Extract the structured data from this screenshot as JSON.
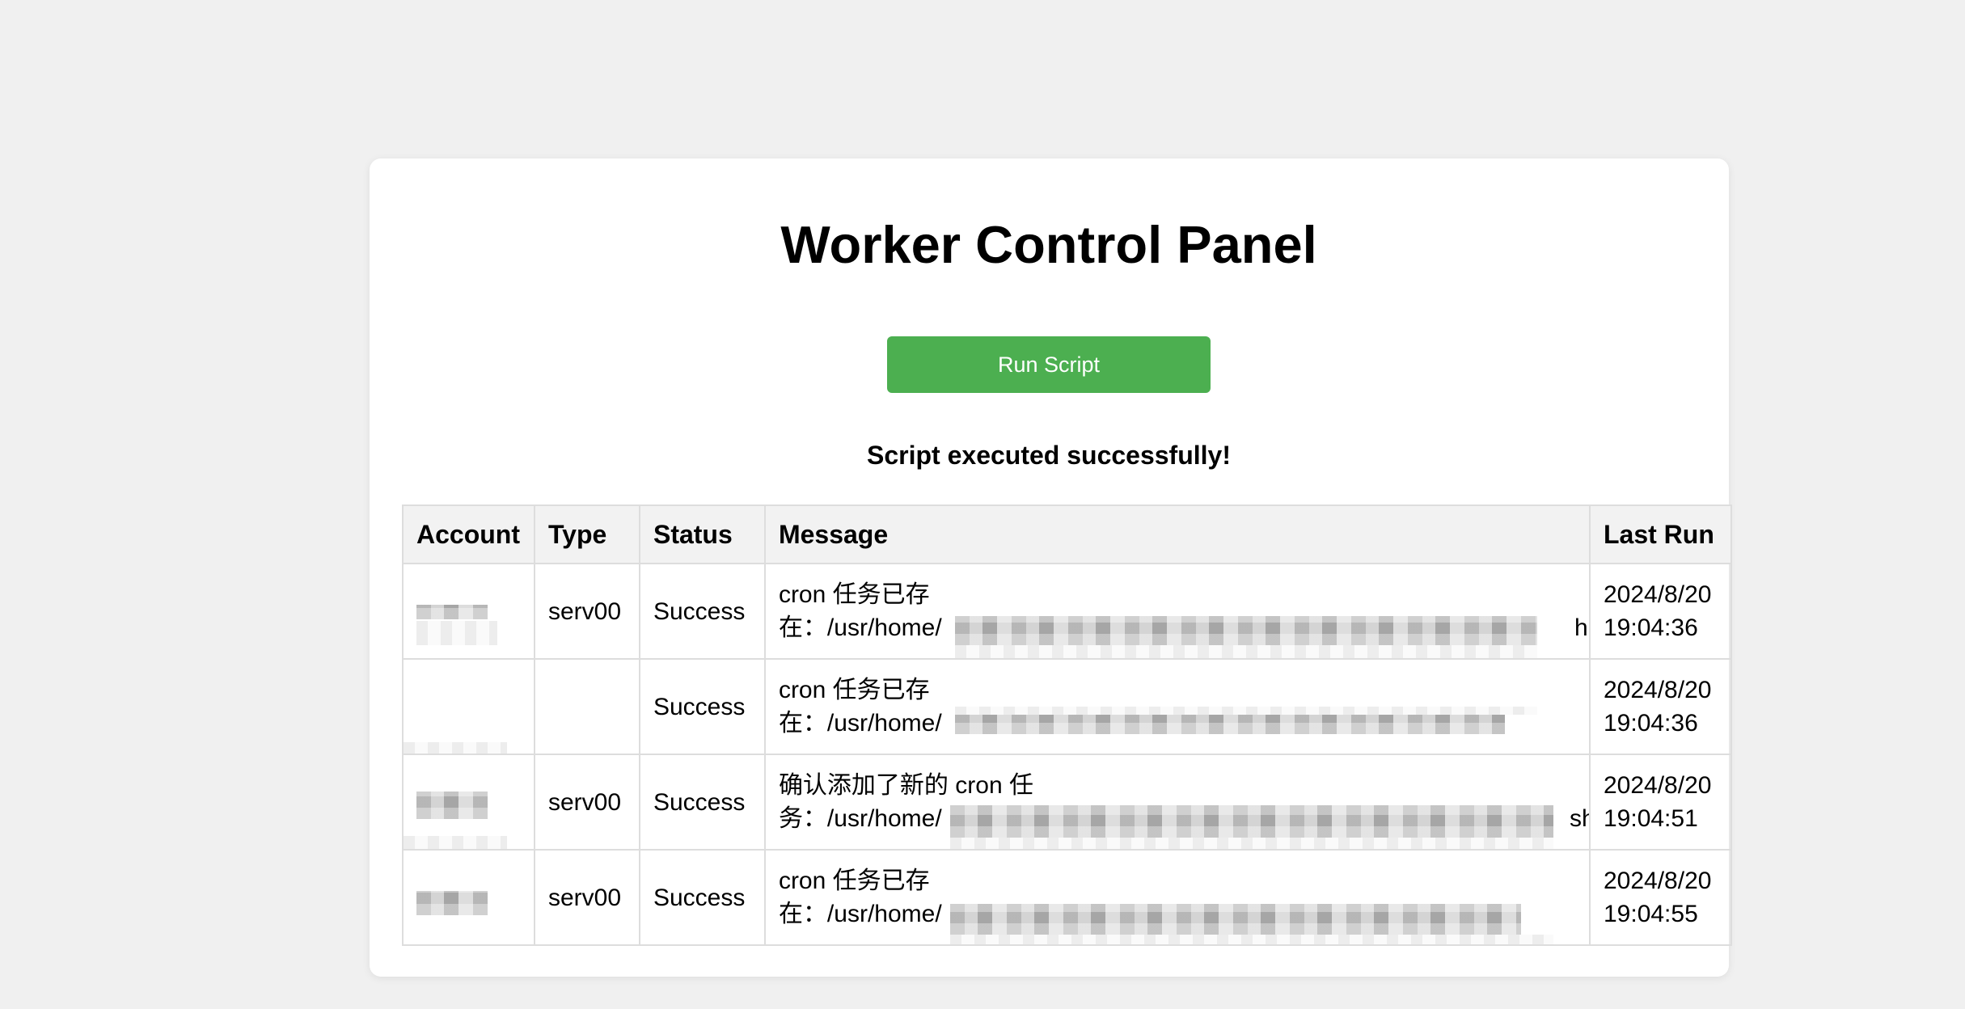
{
  "page": {
    "title": "Worker Control Panel",
    "run_button_label": "Run Script",
    "result_message": "Script executed successfully!"
  },
  "colors": {
    "background": "#f0f0f0",
    "card": "#ffffff",
    "button": "#4caf50",
    "header_bg": "#f2f2f2",
    "border": "#dddddd"
  },
  "table": {
    "headers": {
      "account": "Account",
      "type": "Type",
      "status": "Status",
      "message": "Message",
      "last_run": "Last Run"
    },
    "rows": [
      {
        "account": "",
        "type": "serv00",
        "status": "Success",
        "message_line1": "cron 任务已存",
        "message_line2": "在：/usr/home/",
        "message_tail": "h",
        "last_run_date": "2024/8/20",
        "last_run_time": "19:04:36"
      },
      {
        "account": "",
        "type": "",
        "status": "Success",
        "message_line1": "cron 任务已存",
        "message_line2": "在：/usr/home/",
        "message_tail": "",
        "last_run_date": "2024/8/20",
        "last_run_time": "19:04:36"
      },
      {
        "account": "",
        "type": "serv00",
        "status": "Success",
        "message_line1": "确认添加了新的 cron 任",
        "message_line2": "务：/usr/home/",
        "message_tail": "sh",
        "last_run_date": "2024/8/20",
        "last_run_time": "19:04:51"
      },
      {
        "account": "",
        "type": "serv00",
        "status": "Success",
        "message_line1": "cron 任务已存",
        "message_line2": "在：/usr/home/",
        "message_tail": "",
        "last_run_date": "2024/8/20",
        "last_run_time": "19:04:55"
      }
    ]
  }
}
